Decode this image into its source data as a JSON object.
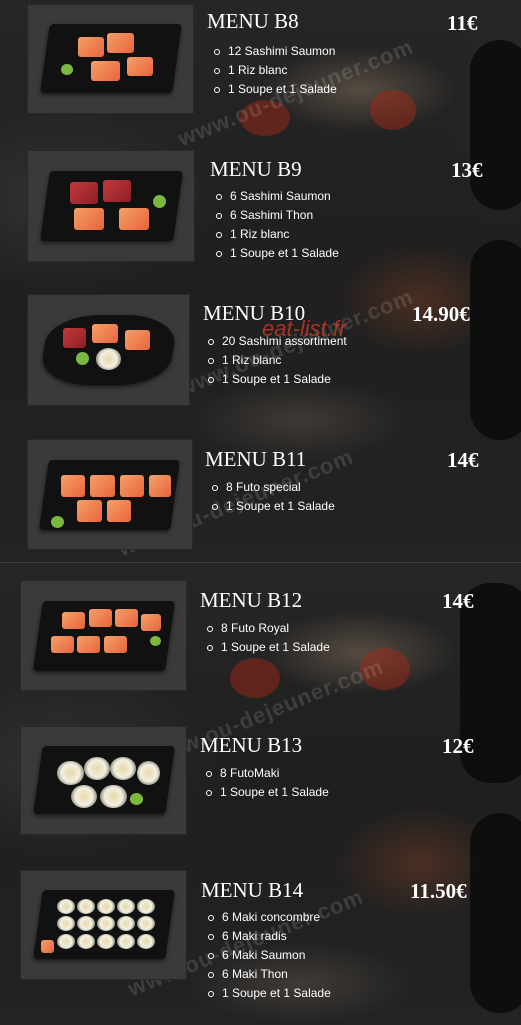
{
  "menus": [
    {
      "title": "MENU B8",
      "price": "11€",
      "lines": [
        "12 Sashimi Saumon",
        "1 Riz blanc",
        "1 Soupe et 1 Salade"
      ]
    },
    {
      "title": "MENU B9",
      "price": "13€",
      "lines": [
        "6 Sashimi Saumon",
        "6 Sashimi Thon",
        "1 Riz blanc",
        "1 Soupe et 1 Salade"
      ]
    },
    {
      "title": "MENU B10",
      "price": "14.90€",
      "lines": [
        "20 Sashimi assortiment",
        "1 Riz blanc",
        "1 Soupe et 1 Salade"
      ]
    },
    {
      "title": "MENU B11",
      "price": "14€",
      "lines": [
        "8 Futo special",
        "1 Soupe et 1 Salade"
      ]
    },
    {
      "title": "MENU B12",
      "price": "14€",
      "lines": [
        "8 Futo Royal",
        "1 Soupe et 1 Salade"
      ]
    },
    {
      "title": "MENU B13",
      "price": "12€",
      "lines": [
        "8 FutoMaki",
        "1 Soupe et 1 Salade"
      ]
    },
    {
      "title": "MENU B14",
      "price": "11.50€",
      "lines": [
        "6 Maki concombre",
        "6 Maki radis",
        "6 Maki Saumon",
        "6 Maki Thon",
        "1 Soupe et 1 Salade"
      ]
    }
  ],
  "watermarks": {
    "site": "www.ou-dejeuner.com",
    "brand": "eat-list.fr"
  },
  "colors": {
    "text": "#ffffff",
    "background": "#1f1f1f",
    "brand_watermark": "#d23c28"
  }
}
